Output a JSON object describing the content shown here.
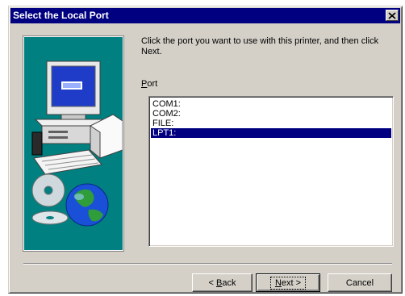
{
  "window": {
    "title": "Select the Local Port",
    "close_glyph": "✕"
  },
  "instruction": "Click the port you want to use with this printer, and then click Next.",
  "port_label": {
    "mnemonic": "P",
    "rest": "ort"
  },
  "ports": [
    {
      "label": "COM1:",
      "selected": false
    },
    {
      "label": "COM2:",
      "selected": false
    },
    {
      "label": "FILE:",
      "selected": false
    },
    {
      "label": "LPT1:",
      "selected": true
    }
  ],
  "buttons": {
    "back": {
      "prefix": "< ",
      "mnemonic": "B",
      "rest": "ack"
    },
    "next": {
      "mnemonic": "N",
      "rest": "ext >"
    },
    "cancel": {
      "label": "Cancel"
    }
  },
  "colors": {
    "title_bar": "#000080",
    "dialog_face": "#d4d0c8",
    "illustration_bg": "#008080",
    "selection": "#000080"
  }
}
